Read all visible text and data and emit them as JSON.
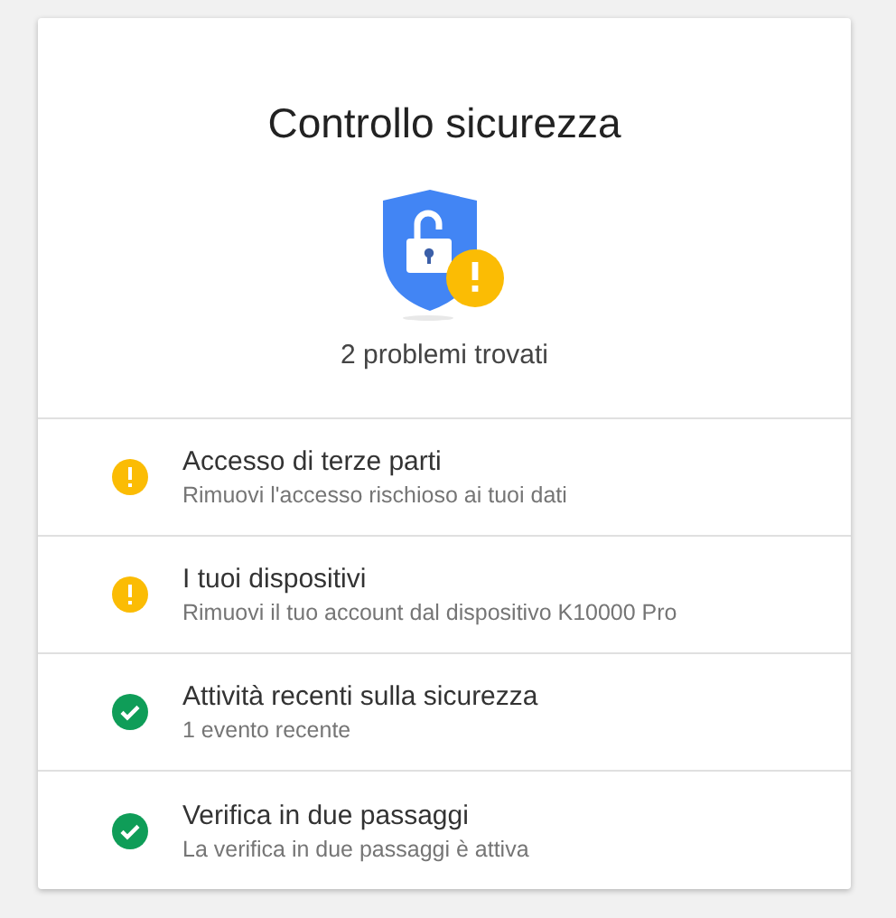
{
  "title": "Controllo sicurezza",
  "summary": "2 problemi trovati",
  "items": [
    {
      "kind": "warning",
      "title": "Accesso di terze parti",
      "subtitle": "Rimuovi l'accesso rischioso ai tuoi dati"
    },
    {
      "kind": "warning",
      "title": "I tuoi dispositivi",
      "subtitle": "Rimuovi il tuo account dal dispositivo K10000 Pro"
    },
    {
      "kind": "ok",
      "title": "Attività recenti sulla sicurezza",
      "subtitle": "1 evento recente"
    },
    {
      "kind": "ok",
      "title": "Verifica in due passaggi",
      "subtitle": "La verifica in due passaggi è attiva"
    }
  ]
}
